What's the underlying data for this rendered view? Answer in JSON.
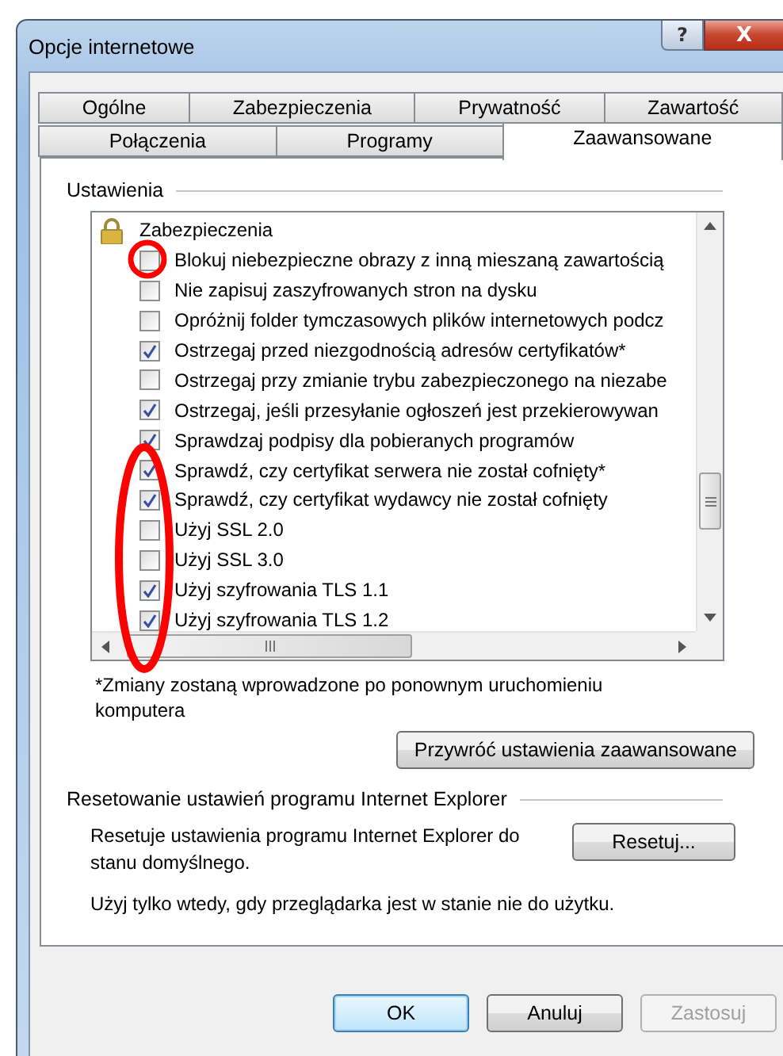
{
  "window": {
    "title": "Opcje internetowe",
    "help_button": "?",
    "close_button": "X"
  },
  "tab_rows": [
    {
      "tabs": [
        {
          "label": "Ogólne",
          "selected": false
        },
        {
          "label": "Zabezpieczenia",
          "selected": false
        },
        {
          "label": "Prywatność",
          "selected": false
        },
        {
          "label": "Zawartość",
          "selected": false
        }
      ]
    },
    {
      "tabs": [
        {
          "label": "Połączenia",
          "selected": false
        },
        {
          "label": "Programy",
          "selected": false
        },
        {
          "label": "Zaawansowane",
          "selected": true
        }
      ]
    }
  ],
  "settings": {
    "group_label": "Ustawienia",
    "tree": {
      "label": "Zabezpieczenia",
      "children": [
        {
          "label": "Blokuj niebezpieczne obrazy z inną mieszaną zawartością",
          "checked": false
        },
        {
          "label": "Nie zapisuj zaszyfrowanych stron na dysku",
          "checked": false
        },
        {
          "label": "Opróżnij folder tymczasowych plików internetowych podcz",
          "checked": false
        },
        {
          "label": "Ostrzegaj przed niezgodnością adresów certyfikatów*",
          "checked": true
        },
        {
          "label": "Ostrzegaj przy zmianie trybu zabezpieczonego na niezabe",
          "checked": false
        },
        {
          "label": "Ostrzegaj, jeśli przesyłanie ogłoszeń jest przekierowywan",
          "checked": true
        },
        {
          "label": "Sprawdzaj podpisy dla pobieranych programów",
          "checked": true
        },
        {
          "label": "Sprawdź, czy certyfikat serwera nie został cofnięty*",
          "checked": true
        },
        {
          "label": "Sprawdź, czy certyfikat wydawcy nie został cofnięty",
          "checked": true
        },
        {
          "label": "Użyj SSL 2.0",
          "checked": false
        },
        {
          "label": "Użyj SSL 3.0",
          "checked": false
        },
        {
          "label": "Użyj szyfrowania TLS 1.1",
          "checked": true
        },
        {
          "label": "Użyj szyfrowania TLS 1.2",
          "checked": true
        }
      ]
    },
    "footnote": "*Zmiany zostaną wprowadzone po ponownym uruchomieniu komputera",
    "restore_button": "Przywróć ustawienia zaawansowane"
  },
  "reset": {
    "group_label": "Resetowanie ustawień programu Internet Explorer",
    "description": "Resetuje ustawienia programu Internet Explorer do stanu domyślnego.",
    "button": "Resetuj...",
    "note": "Użyj tylko wtedy, gdy przeglądarka jest w stanie nie do użytku."
  },
  "buttons": [
    {
      "label": "OK",
      "default": true,
      "disabled": false
    },
    {
      "label": "Anuluj",
      "default": false,
      "disabled": false
    },
    {
      "label": "Zastosuj",
      "default": false,
      "disabled": true
    }
  ],
  "annotations": [
    {
      "kind": "circle"
    },
    {
      "kind": "ellipse"
    }
  ]
}
